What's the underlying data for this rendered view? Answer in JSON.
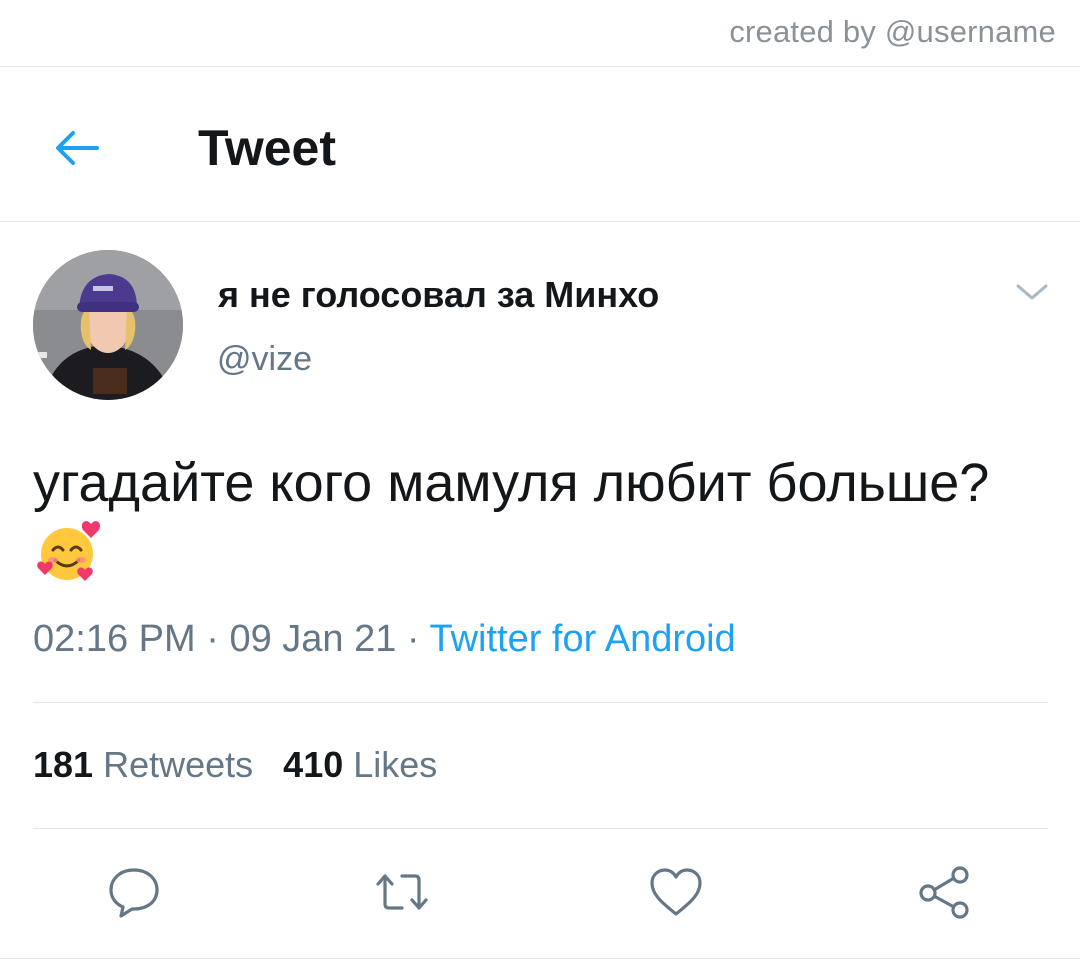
{
  "credit": "created by @username",
  "header": {
    "title": "Tweet",
    "back_icon": "arrow-left-icon"
  },
  "author": {
    "display_name": "я не голосовал за Минхо",
    "handle": "@vize"
  },
  "tweet": {
    "text": "угадайте кого мамуля любит больше?",
    "emoji": "smiling-face-with-hearts"
  },
  "meta": {
    "time": "02:16 PM",
    "separator": " · ",
    "date": "09 Jan 21",
    "source": "Twitter for Android"
  },
  "stats": {
    "retweets_count": "181",
    "retweets_label": "Retweets",
    "likes_count": "410",
    "likes_label": "Likes"
  },
  "actions": [
    "reply-icon",
    "retweet-icon",
    "like-icon",
    "share-icon"
  ],
  "colors": {
    "accent": "#1da1f2",
    "text": "#14171a",
    "secondary": "#657786",
    "divider": "#e3e6e8"
  }
}
